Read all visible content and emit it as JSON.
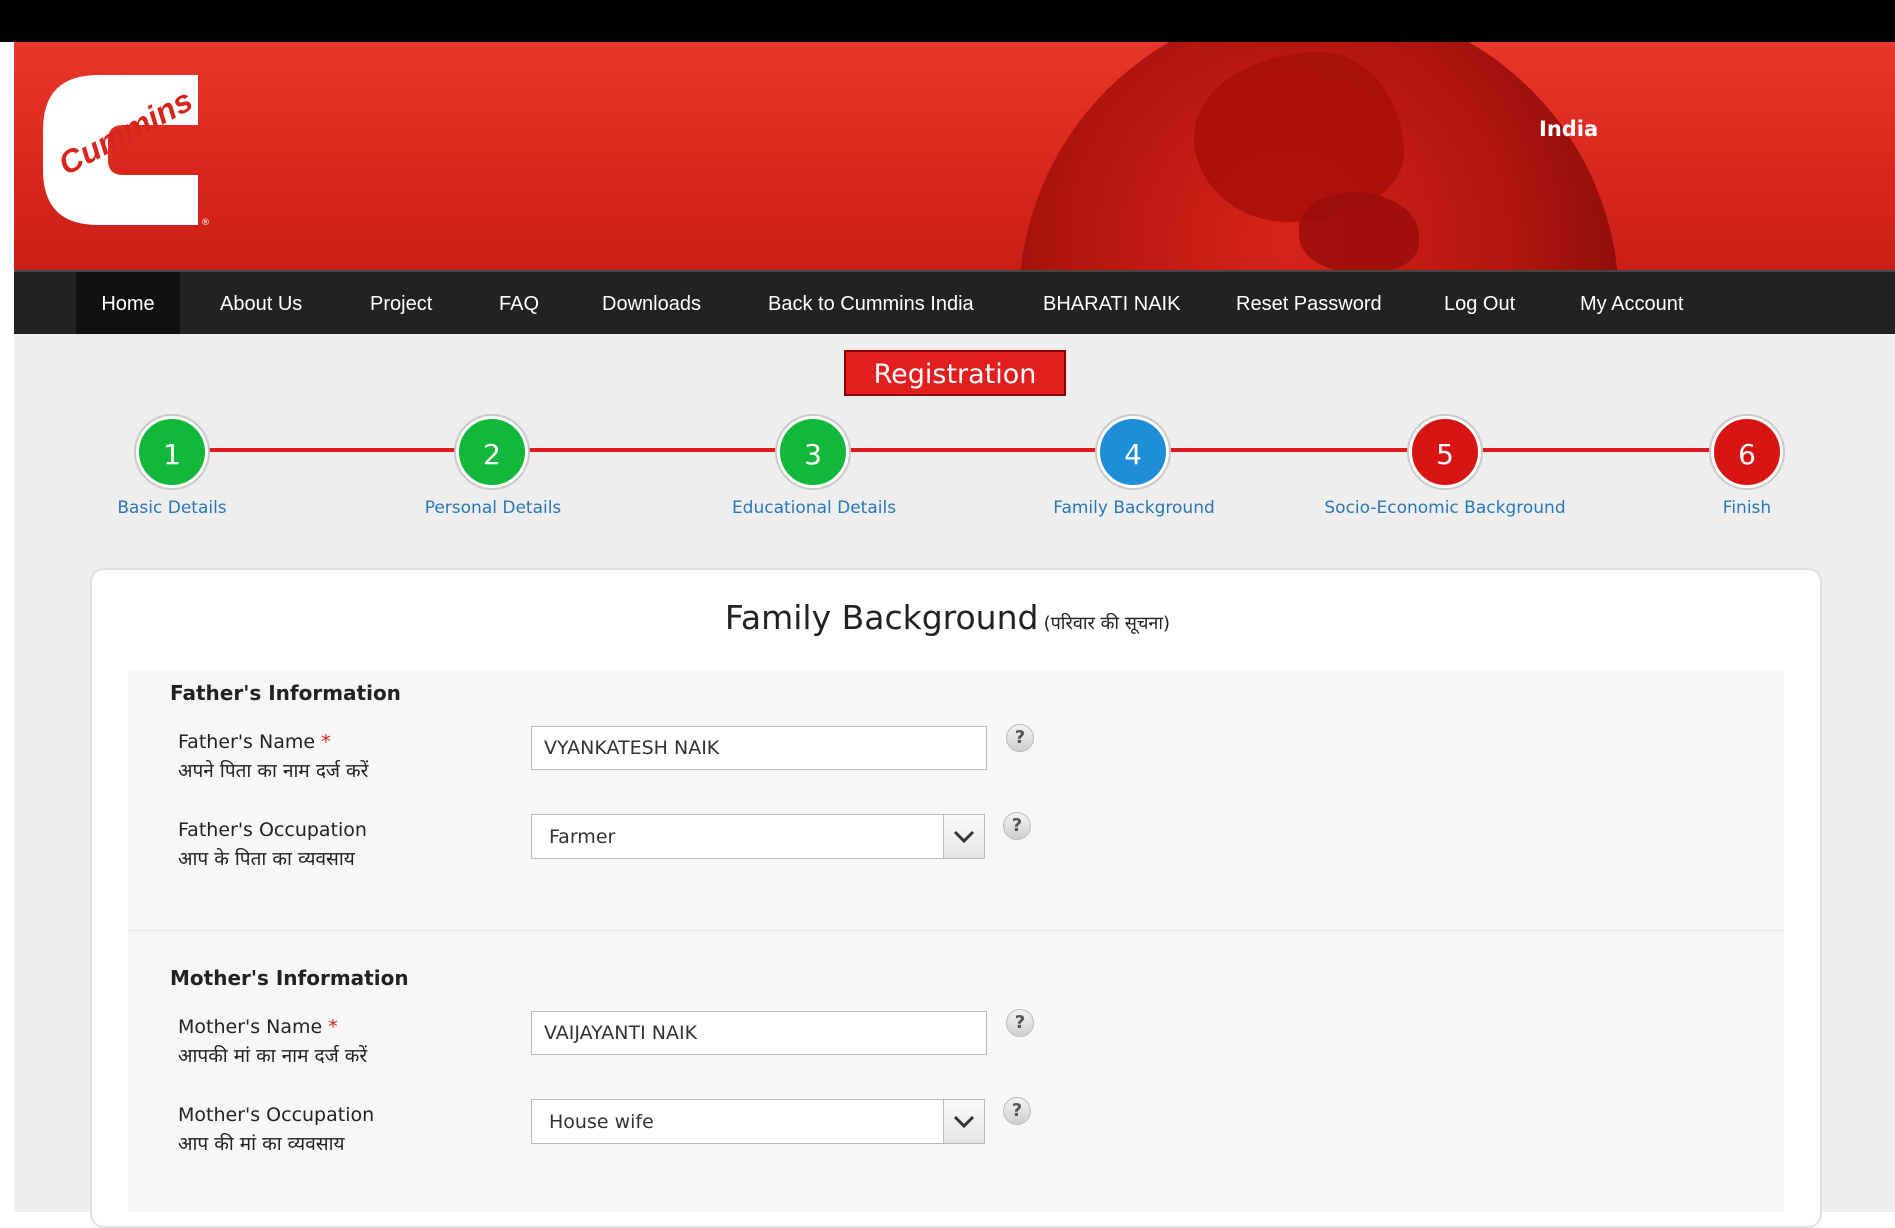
{
  "brand": {
    "logo_text": "Cummins",
    "region": "India"
  },
  "nav": {
    "items": [
      "Home",
      "About Us",
      "Project",
      "FAQ",
      "Downloads",
      "Back to Cummins India",
      "BHARATI NAIK",
      "Reset Password",
      "Log Out",
      "My Account"
    ]
  },
  "registration": {
    "label": "Registration"
  },
  "steps": [
    {
      "number": "1",
      "label": "Basic Details",
      "color": "#12b83a"
    },
    {
      "number": "2",
      "label": "Personal Details",
      "color": "#12b83a"
    },
    {
      "number": "3",
      "label": "Educational Details",
      "color": "#12b83a"
    },
    {
      "number": "4",
      "label": "Family Background",
      "color": "#1f8ed8"
    },
    {
      "number": "5",
      "label": "Socio-Economic Background",
      "color": "#d91414"
    },
    {
      "number": "6",
      "label": "Finish",
      "color": "#d91414"
    }
  ],
  "form": {
    "title": "Family Background",
    "title_hindi": "(परिवार की सूचना)",
    "father": {
      "heading": "Father's Information",
      "name_label": "Father's Name",
      "required_mark": "*",
      "name_hindi": "अपने पिता का नाम दर्ज करें",
      "name_value": "VYANKATESH NAIK",
      "occupation_label": "Father's Occupation",
      "occupation_hindi": "आप के पिता का व्यवसाय",
      "occupation_value": "Farmer"
    },
    "mother": {
      "heading": "Mother's Information",
      "name_label": "Mother's Name",
      "required_mark": "*",
      "name_hindi": "आपकी मां का नाम दर्ज करें",
      "name_value": "VAIJAYANTI NAIK",
      "occupation_label": "Mother's Occupation",
      "occupation_hindi": "आप की मां का व्यवसाय",
      "occupation_value": "House wife"
    },
    "help_glyph": "?"
  }
}
